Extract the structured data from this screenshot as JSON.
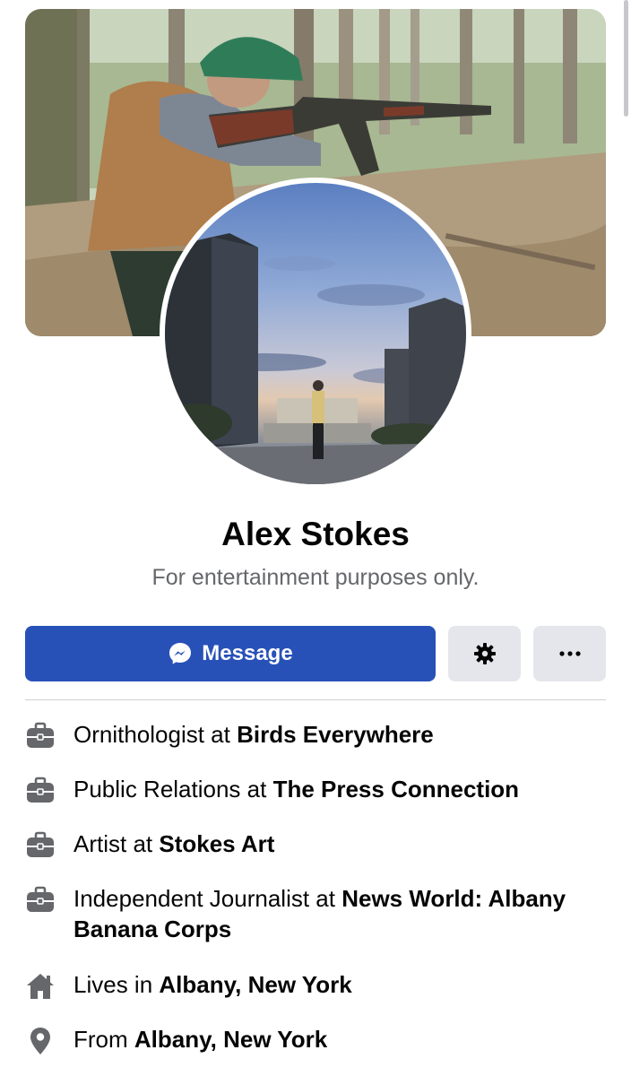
{
  "profile": {
    "name": "Alex Stokes",
    "bio": "For entertainment purposes only."
  },
  "actions": {
    "message_label": "Message",
    "message_icon": "messenger-icon",
    "settings_icon": "gear-icon",
    "more_icon": "more-icon",
    "accent_color": "#2851b8"
  },
  "details": [
    {
      "icon": "briefcase-icon",
      "prefix": "Ornithologist at ",
      "bold": "Birds Everywhere"
    },
    {
      "icon": "briefcase-icon",
      "prefix": "Public Relations at ",
      "bold": "The Press Connection"
    },
    {
      "icon": "briefcase-icon",
      "prefix": "Artist at ",
      "bold": "Stokes Art"
    },
    {
      "icon": "briefcase-icon",
      "prefix": "Independent Journalist at ",
      "bold": "News World: Albany Banana Corps"
    },
    {
      "icon": "home-icon",
      "prefix": "Lives in ",
      "bold": "Albany, New York"
    },
    {
      "icon": "location-pin-icon",
      "prefix": "From ",
      "bold": "Albany, New York"
    }
  ]
}
